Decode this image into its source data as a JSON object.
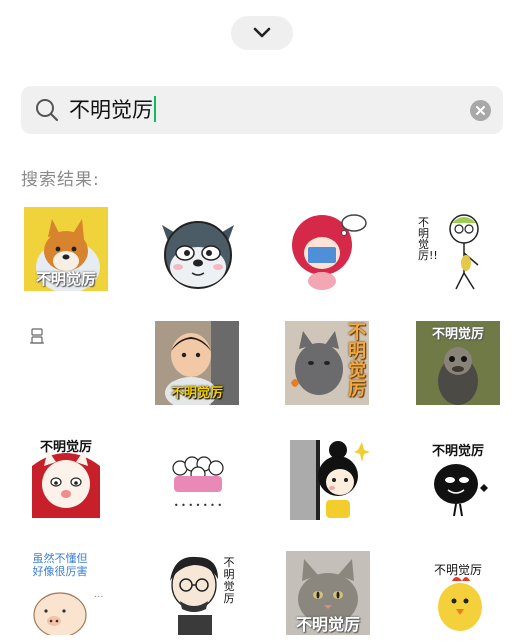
{
  "panel": {
    "collapse_icon": "chevron-down-icon"
  },
  "search": {
    "icon": "search-icon",
    "query": "不明觉厉",
    "clear_icon": "clear-icon",
    "accent_caret": "#07c160"
  },
  "results": {
    "label": "搜索结果:",
    "stickers": [
      {
        "name": "shiba-dog-sticker",
        "caption": "不明觉厉"
      },
      {
        "name": "husky-face-sticker",
        "caption": ""
      },
      {
        "name": "red-hair-girl-reading-sticker",
        "caption": ""
      },
      {
        "name": "stick-figure-sticker",
        "caption": "不明觉厉!!"
      },
      {
        "name": "loading-placeholder-icon",
        "caption": ""
      },
      {
        "name": "toddler-photo-sticker",
        "caption": "不明觉厉"
      },
      {
        "name": "grey-cat-photo-sticker",
        "caption": "不明觉厉"
      },
      {
        "name": "ostrich-photo-sticker",
        "caption": "不明觉厉"
      },
      {
        "name": "red-hood-cat-sticker",
        "caption": "不明觉厉"
      },
      {
        "name": "five-pink-figures-sticker",
        "caption": ""
      },
      {
        "name": "peeking-girl-sticker",
        "caption": ""
      },
      {
        "name": "black-blob-sticker",
        "caption": "不明觉厉"
      },
      {
        "name": "pig-sticker",
        "caption": "虽然不懂但好像很厉害"
      },
      {
        "name": "glasses-man-sticker",
        "caption": "不明觉厉"
      },
      {
        "name": "tabby-cat-photo-sticker",
        "caption": "不明觉厉"
      },
      {
        "name": "yellow-chick-sticker",
        "caption": "不明觉厉"
      }
    ]
  }
}
